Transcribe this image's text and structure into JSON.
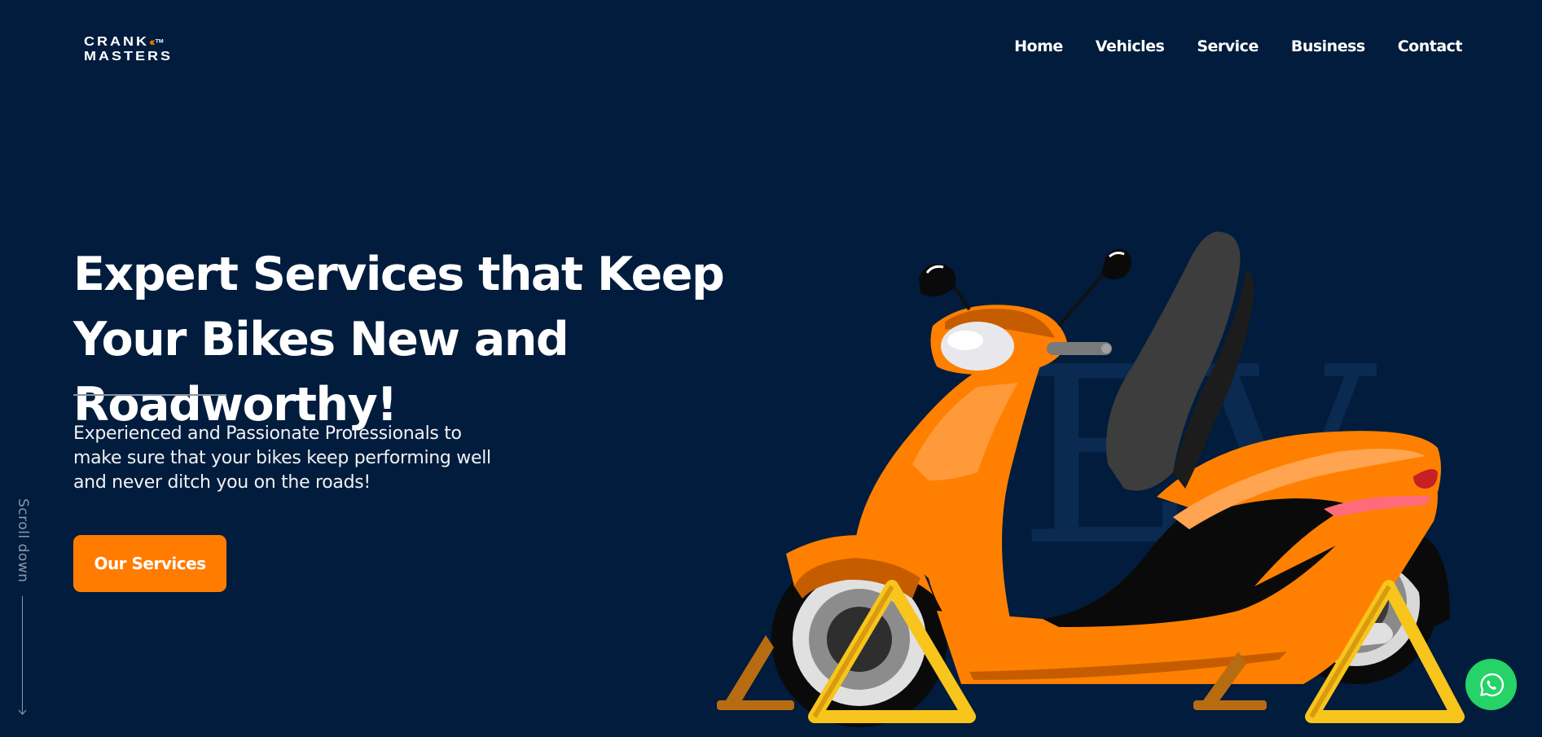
{
  "brand": {
    "line1": "CRANK",
    "line2": "MASTERS",
    "chevrons": "‹‹",
    "trademark": "TM"
  },
  "nav": {
    "items": [
      {
        "label": "Home"
      },
      {
        "label": "Vehicles"
      },
      {
        "label": "Service"
      },
      {
        "label": "Business"
      },
      {
        "label": "Contact"
      }
    ]
  },
  "hero": {
    "title": "Expert Services that Keep Your Bikes New and Roadworthy!",
    "subtitle": "Experienced and Passionate Professionals to make sure that your bikes keep performing well and never ditch you on the roads!",
    "cta_label": "Our Services",
    "watermark": "EV"
  },
  "scroll": {
    "label": "Scroll down"
  },
  "colors": {
    "background": "#011c3c",
    "accent": "#ff7c00",
    "whatsapp": "#25d366"
  },
  "icons": {
    "whatsapp": "whatsapp-icon",
    "scroll_arrow": "arrow-down-icon"
  }
}
